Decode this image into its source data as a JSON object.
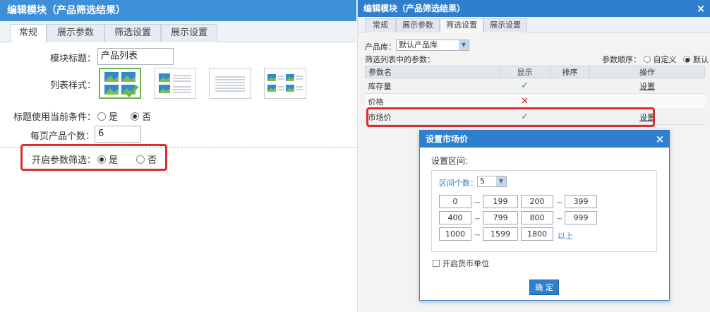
{
  "left": {
    "title": "编辑模块（产品筛选结果）",
    "tabs": [
      "常规",
      "展示参数",
      "筛选设置",
      "展示设置"
    ],
    "module_title_label": "模块标题：",
    "module_title_value": "产品列表",
    "list_style_label": "列表样式：",
    "use_condition_label": "标题使用当前条件：",
    "use_condition_yes": "是",
    "use_condition_no": "否",
    "per_page_label": "每页产品个数：",
    "per_page_value": "6",
    "param_filter_label": "开启参数筛选：",
    "param_filter_yes": "是",
    "param_filter_no": "否"
  },
  "right": {
    "title": "编辑模块（产品筛选结果）",
    "tabs": [
      "常规",
      "展示参数",
      "筛选设置",
      "展示设置"
    ],
    "library_label": "产品库：",
    "library_value": "默认产品库",
    "params_in_list_label": "筛选列表中的参数：",
    "param_order_label": "参数顺序：",
    "order_custom": "自定义",
    "order_default": "默认",
    "table_headers": [
      "参数名",
      "显示",
      "排序",
      "操作"
    ],
    "rows": [
      {
        "name": "库存量",
        "op": "设置"
      },
      {
        "name": "价格",
        "op": ""
      },
      {
        "name": "市场价",
        "op": "设置"
      }
    ]
  },
  "dialog": {
    "title": "设置市场价",
    "range_label": "设置区间:",
    "count_label": "区间个数：",
    "count_value": "5",
    "ranges": [
      [
        "0",
        "199"
      ],
      [
        "200",
        "399"
      ],
      [
        "400",
        "799"
      ],
      [
        "800",
        "999"
      ],
      [
        "1000",
        "1599"
      ]
    ],
    "last_value": "1800",
    "last_suffix": "以上",
    "tilde": "~",
    "currency_label": "开启货币单位",
    "ok_label": "确 定"
  },
  "colors": {
    "title_blue": "#3d8fd8",
    "highlight_red": "#e02b2b",
    "check_green": "#3c9a2e"
  }
}
